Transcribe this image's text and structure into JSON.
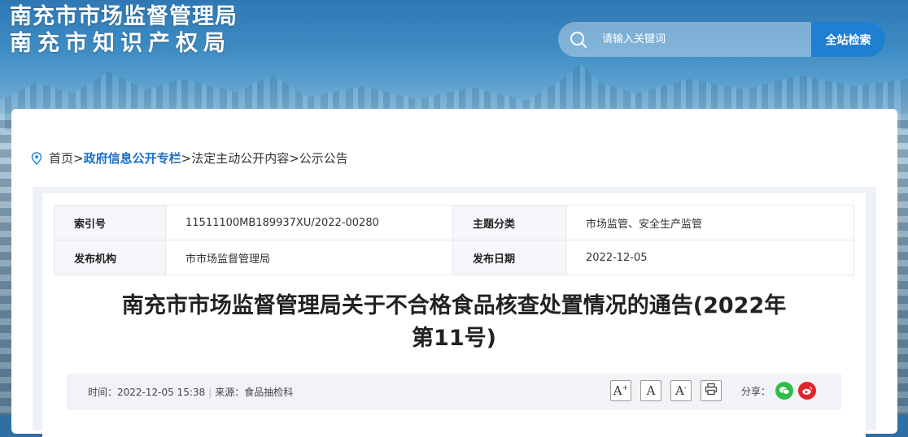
{
  "header": {
    "title_line1": "南充市市场监督管理局",
    "title_line2": "南充市知识产权局"
  },
  "search": {
    "placeholder": "请输入关键词",
    "button_label": "全站检索"
  },
  "breadcrumb": {
    "home": "首页",
    "sep1": ">",
    "section": "政府信息公开专栏",
    "sep2": ">",
    "sub": "法定主动公开内容",
    "sep3": ">",
    "current": "公示公告"
  },
  "meta": {
    "index_label": "索引号",
    "index_value": "11511100MB189937XU/2022-00280",
    "topic_label": "主题分类",
    "topic_value": "市场监管、安全生产监管",
    "org_label": "发布机构",
    "org_value": "市市场监督管理局",
    "date_label": "发布日期",
    "date_value": "2022-12-05"
  },
  "article": {
    "title_line1": "南充市市场监督管理局关于不合格食品核查处置情况的通告(2022年",
    "title_line2": "第11号)",
    "time_text": "时间：2022-12-05 15:38",
    "separator": "|",
    "source_text": "来源：食品抽检科",
    "share_label": "分享："
  },
  "tools": {
    "font_large": "A",
    "font_large_mark": "+",
    "font_normal": "A",
    "font_small": "A",
    "font_small_mark": "-"
  },
  "colors": {
    "accent": "#1f7fd1",
    "link": "#1a6fc9",
    "wechat": "#2dbe48",
    "weibo": "#e0232d"
  }
}
